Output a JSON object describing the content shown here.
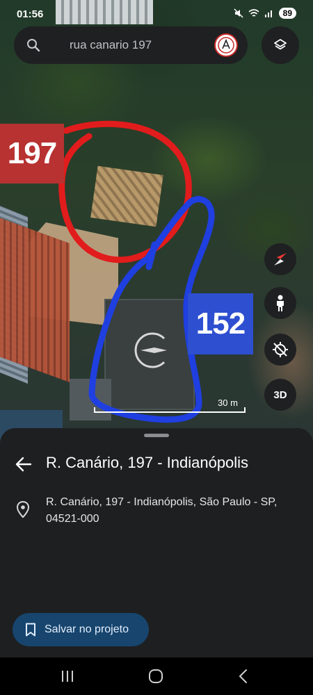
{
  "status_bar": {
    "time": "01:56",
    "battery": "89"
  },
  "search": {
    "query": "rua canario 197"
  },
  "annotations": {
    "red_label": "197",
    "blue_label": "152"
  },
  "map_controls": {
    "three_d": "3D"
  },
  "scale": {
    "label": "30 m"
  },
  "place_sheet": {
    "title": "R. Canário, 197 - Indianópolis",
    "address_line1": "R. Canário, 197 - Indianópolis, São Paulo - SP,",
    "address_line2": "04521-000",
    "save_label": "Salvar no projeto"
  },
  "colors": {
    "annotation_red": "#e11c1c",
    "annotation_blue": "#1f3fe0",
    "sheet_bg": "#1e1f21",
    "save_button_bg": "#17456e"
  }
}
